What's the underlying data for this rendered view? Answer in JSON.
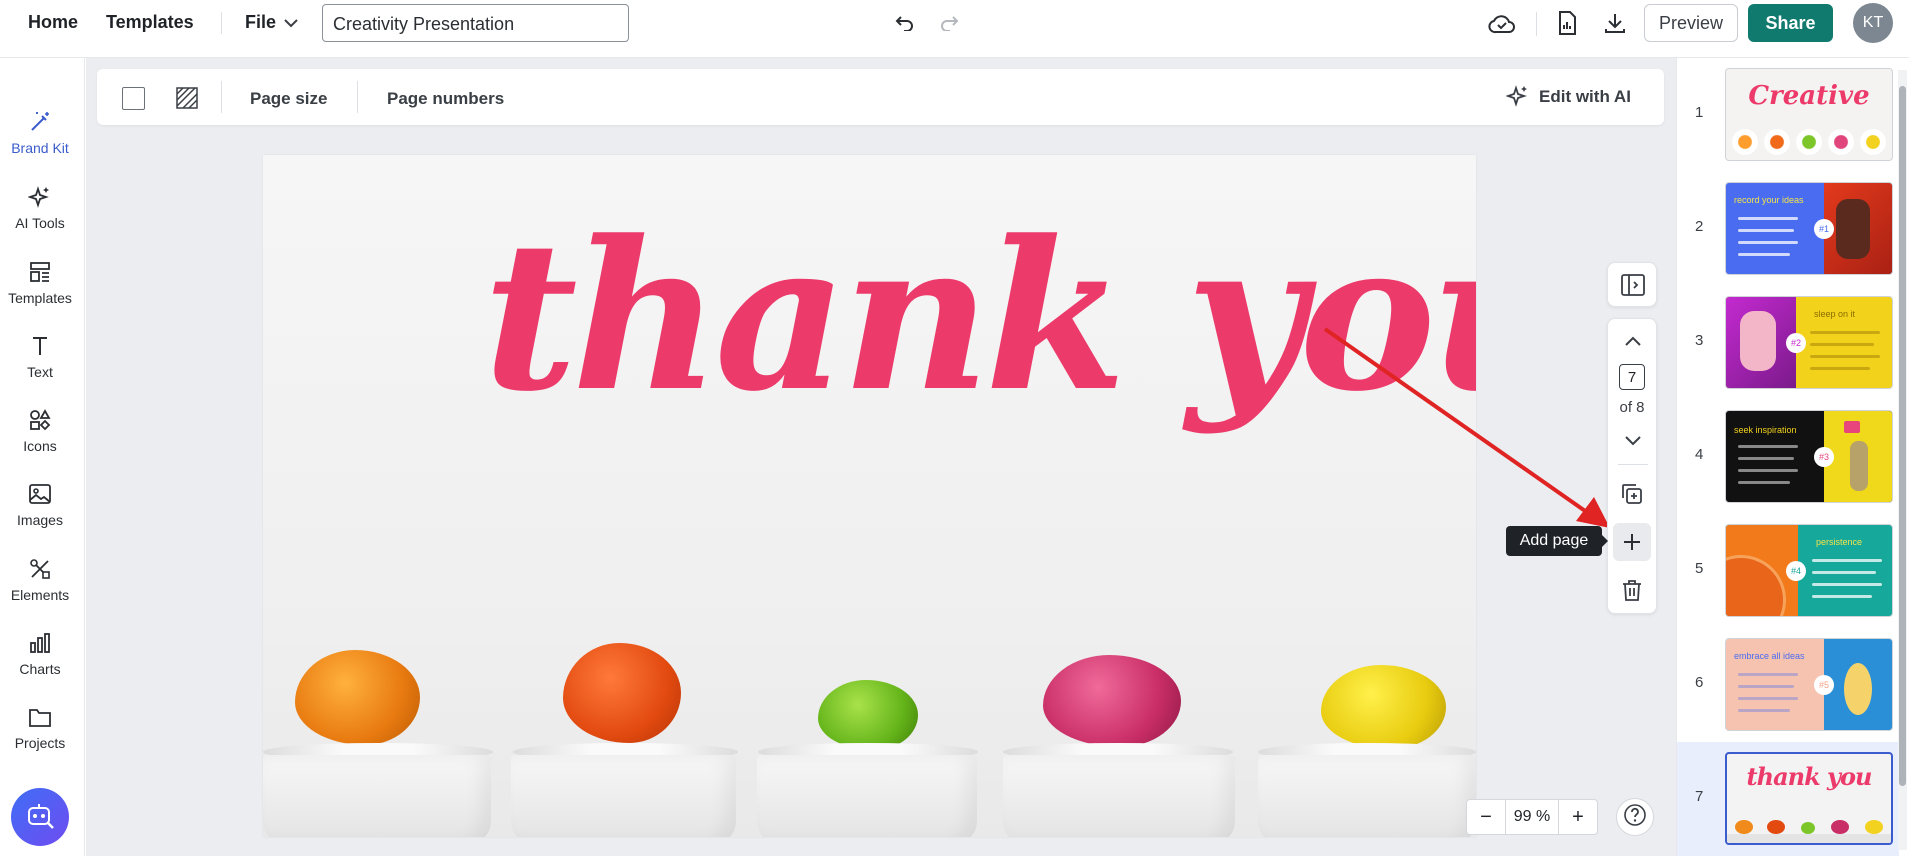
{
  "topbar": {
    "home": "Home",
    "templates": "Templates",
    "file": "File",
    "doc_title": "Creativity Presentation",
    "preview": "Preview",
    "share": "Share",
    "avatar": "KT"
  },
  "sidebar": {
    "items": [
      {
        "label": "Brand Kit",
        "icon": "magic-wand-icon"
      },
      {
        "label": "AI Tools",
        "icon": "sparkles-icon"
      },
      {
        "label": "Templates",
        "icon": "template-icon"
      },
      {
        "label": "Text",
        "icon": "text-icon"
      },
      {
        "label": "Icons",
        "icon": "shapes-icon"
      },
      {
        "label": "Images",
        "icon": "image-icon"
      },
      {
        "label": "Elements",
        "icon": "elements-icon"
      },
      {
        "label": "Charts",
        "icon": "bar-chart-icon"
      },
      {
        "label": "Projects",
        "icon": "folder-icon"
      }
    ]
  },
  "toolbar": {
    "page_size": "Page size",
    "page_numbers": "Page numbers",
    "edit_with_ai": "Edit with AI"
  },
  "canvas": {
    "headline": "thank you",
    "headline_color": "#ec3b6b"
  },
  "page_controls": {
    "current_page": "7",
    "total_label": "of 8",
    "tooltip": "Add page"
  },
  "zoom": {
    "minus": "−",
    "value": "99 %",
    "plus": "+"
  },
  "thumbnails": {
    "pages": [
      {
        "num": "1",
        "text": "Creative"
      },
      {
        "num": "2",
        "text": "record your ideas",
        "badge": "#1"
      },
      {
        "num": "3",
        "text": "sleep on it",
        "badge": "#2"
      },
      {
        "num": "4",
        "text": "seek inspiration",
        "badge": "#3"
      },
      {
        "num": "5",
        "text": "persistence",
        "badge": "#4"
      },
      {
        "num": "6",
        "text": "embrace all ideas",
        "badge": "#5"
      },
      {
        "num": "7",
        "text": "thank you"
      }
    ]
  },
  "colors": {
    "accent": "#3a5ccc",
    "share": "#117a6e",
    "brand_pink": "#ec3b6b"
  }
}
